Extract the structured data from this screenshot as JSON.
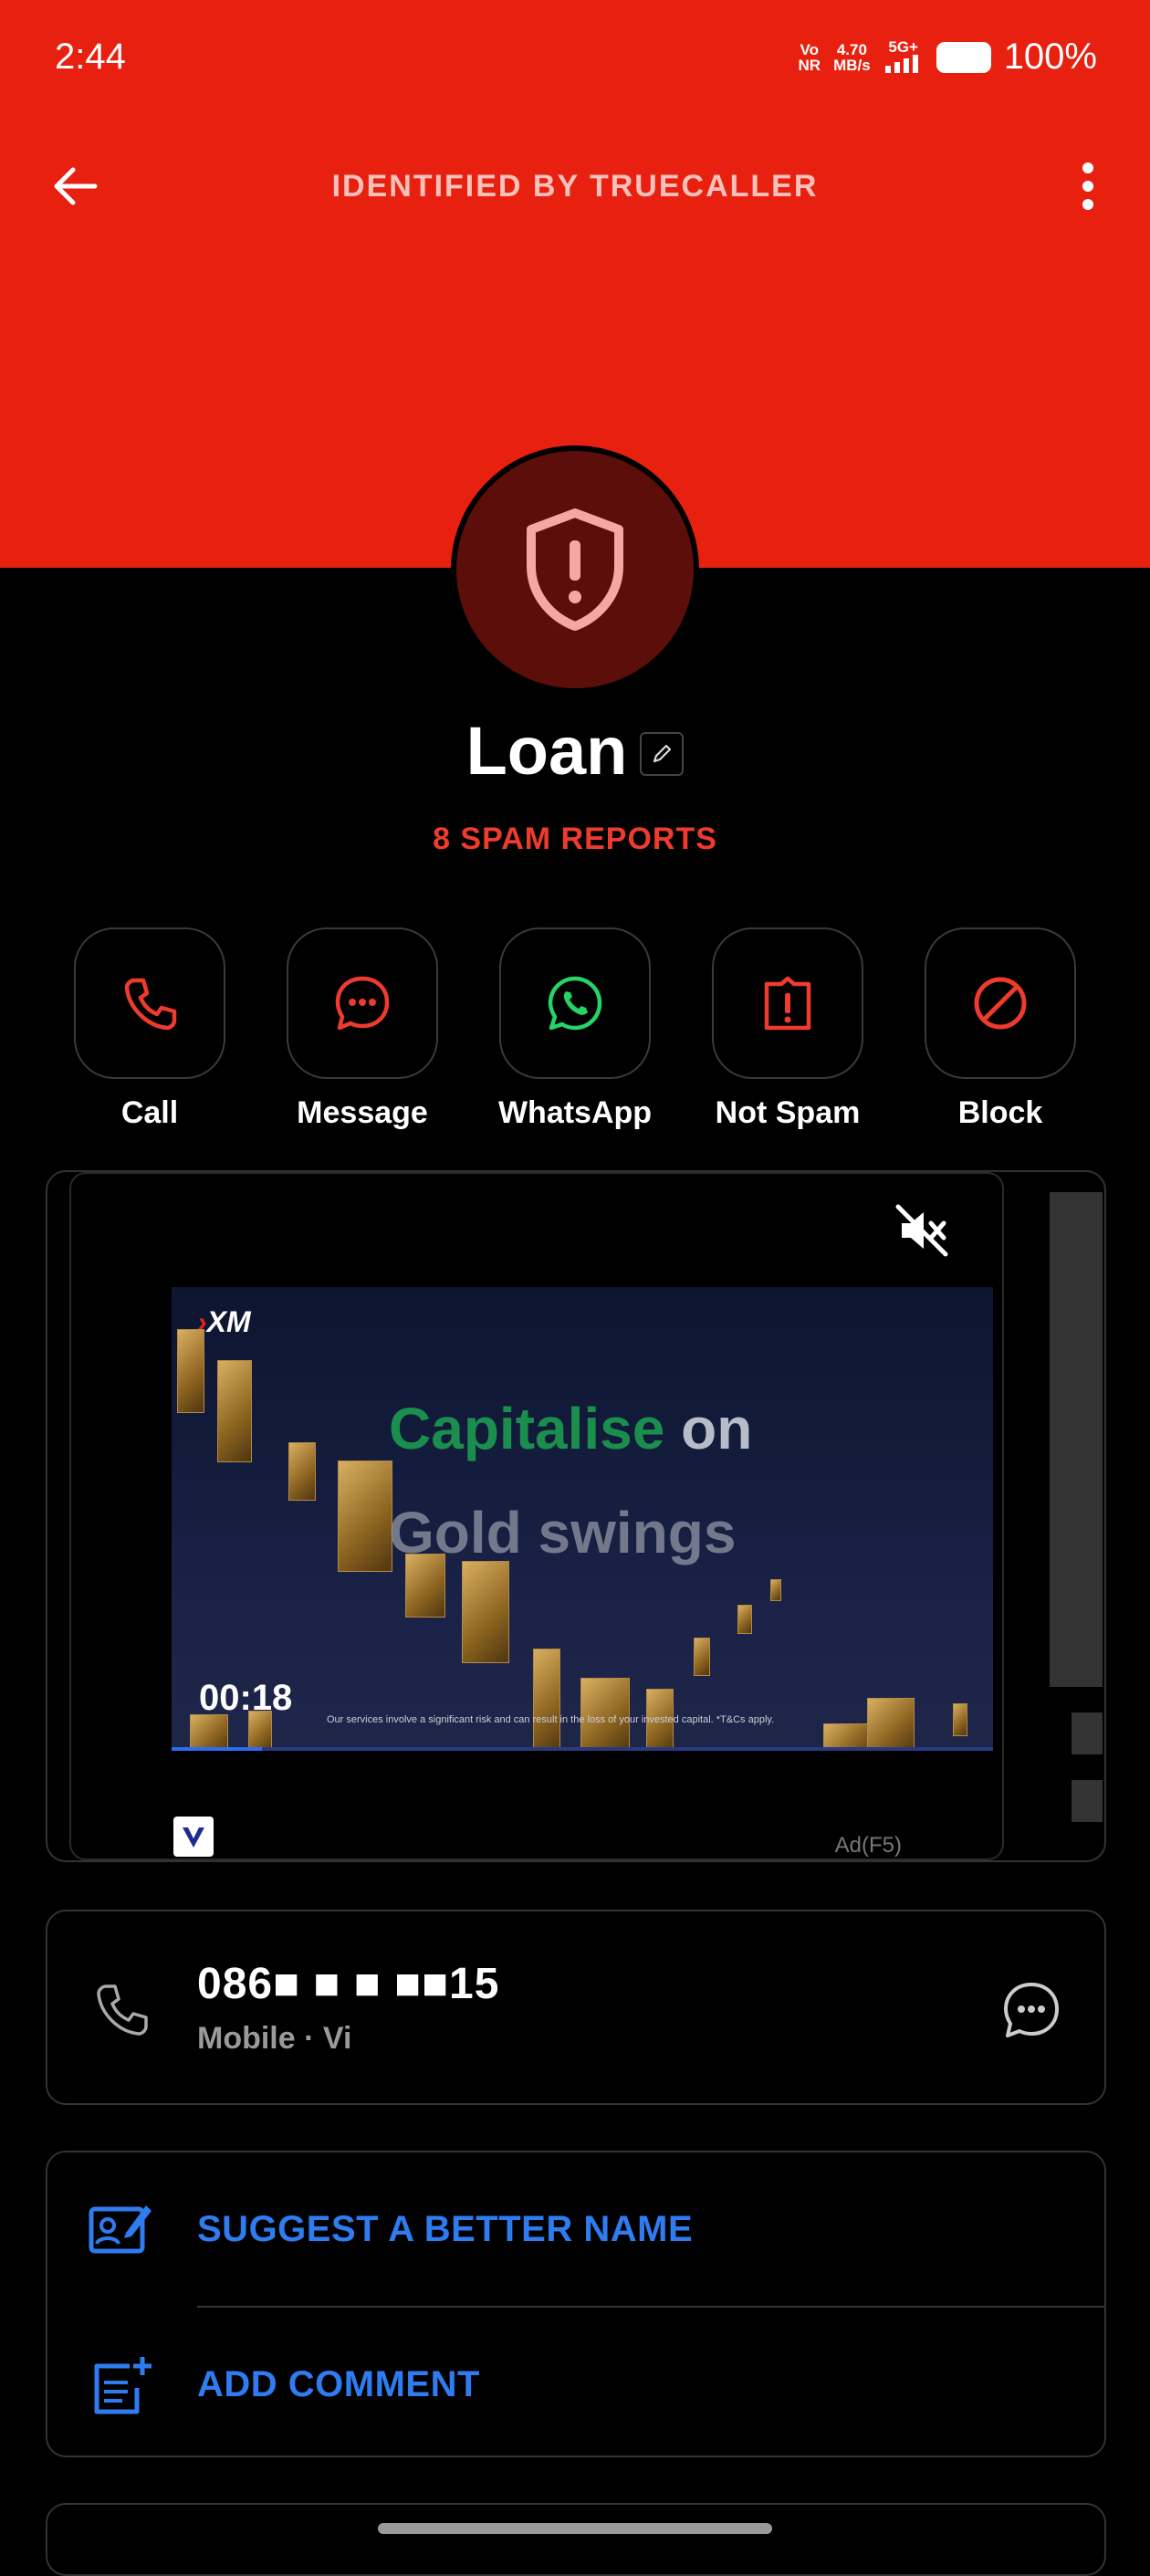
{
  "status_bar": {
    "time": "2:44",
    "network_top": "Vo",
    "network_bottom": "NR",
    "speed_value": "4.70",
    "speed_unit": "MB/s",
    "signal_type": "5G+",
    "battery_percent": "100%"
  },
  "header": {
    "title": "IDENTIFIED BY TRUECALLER",
    "back_icon": "arrow-left-icon",
    "more_icon": "more-vertical-icon",
    "brand_color": "#e8200f"
  },
  "profile": {
    "name": "Loan",
    "spam_reports": "8 SPAM REPORTS",
    "avatar_icon": "shield-alert-icon"
  },
  "actions": [
    {
      "label": "Call",
      "icon": "phone-icon",
      "color": "#ef3b2d"
    },
    {
      "label": "Message",
      "icon": "message-icon",
      "color": "#ef3b2d"
    },
    {
      "label": "WhatsApp",
      "icon": "whatsapp-icon",
      "color": "#25d366"
    },
    {
      "label": "Not Spam",
      "icon": "alert-box-icon",
      "color": "#ef3b2d"
    },
    {
      "label": "Block",
      "icon": "block-icon",
      "color": "#ef3b2d"
    }
  ],
  "ad": {
    "brand": "XM",
    "headline_green": "Capitalise",
    "headline_rest": "on",
    "headline_line2": "Gold swings",
    "timer": "00:18",
    "disclaimer": "Our services involve a significant risk and can result in the loss of your invested capital. *T&Cs apply.",
    "label": "Ad(F5)",
    "progress": 0.11
  },
  "number": {
    "value": "086■ ■ ■ ■■15",
    "subtitle": "Mobile · Vi"
  },
  "options": [
    {
      "label": "SUGGEST A BETTER NAME",
      "icon": "edit-contact-icon"
    },
    {
      "label": "ADD COMMENT",
      "icon": "add-note-icon"
    }
  ]
}
